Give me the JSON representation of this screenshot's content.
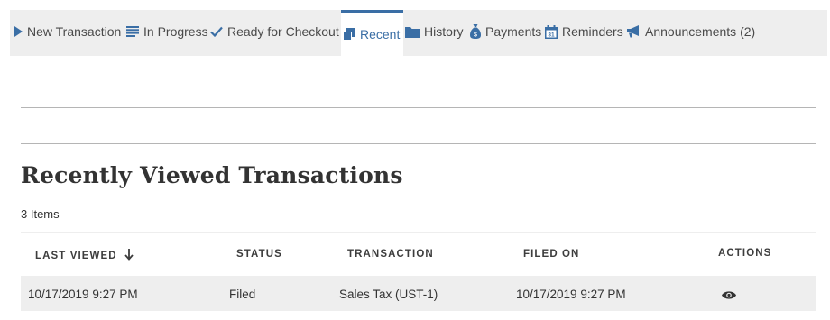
{
  "nav": {
    "items": [
      {
        "label": "New Transaction",
        "icon": "play-icon"
      },
      {
        "label": "In Progress",
        "icon": "list-icon"
      },
      {
        "label": "Ready for Checkout",
        "icon": "check-icon"
      },
      {
        "label": "Recent",
        "icon": "copy-icon",
        "active": true
      },
      {
        "label": "History",
        "icon": "folder-icon"
      },
      {
        "label": "Payments",
        "icon": "money-bag-icon"
      },
      {
        "label": "Reminders",
        "icon": "calendar-icon"
      },
      {
        "label": "Announcements (2)",
        "icon": "megaphone-icon"
      }
    ],
    "calendar_day": "31"
  },
  "page": {
    "title": "Recently Viewed Transactions",
    "count": "3 Items"
  },
  "table": {
    "columns": [
      "LAST VIEWED",
      "STATUS",
      "TRANSACTION",
      "FILED ON",
      "ACTIONS"
    ],
    "sort_icon": "arrow-down-icon",
    "rows": [
      {
        "last_viewed": "10/17/2019 9:27 PM",
        "status": "Filed",
        "transaction": "Sales Tax (UST-1)",
        "filed_on": "10/17/2019 9:27 PM",
        "action_icon": "eye-icon"
      }
    ]
  },
  "colors": {
    "nav_bg": "#eeeeee",
    "nav_icon": "#3a6ea5",
    "row_bg": "#eeeeee",
    "divider": "#b5b5b5"
  }
}
